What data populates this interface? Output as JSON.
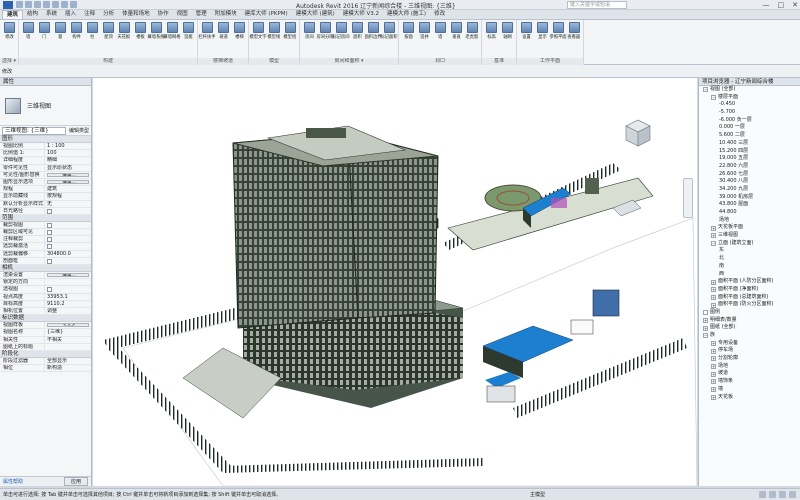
{
  "title_bar": {
    "title": "Autodesk Revit 2016    辽宁新闻综合楼 - 三维视图: {三维}",
    "search_placeholder": "键入关键字或短语",
    "win_controls": [
      "—",
      "□",
      "✕"
    ]
  },
  "ribbon_tabs": [
    "建筑",
    "结构",
    "系统",
    "插入",
    "注释",
    "分析",
    "体量和场地",
    "协作",
    "视图",
    "管理",
    "附加模块",
    "建库大师 (PKPM)",
    "建模大师 (建筑)",
    "建模大师 V3.2",
    "建模大师 (施工)",
    "修改"
  ],
  "active_tab": 0,
  "ribbon_groups": [
    {
      "name": "选择 ▾",
      "buttons": [
        "修改"
      ]
    },
    {
      "name": "构建",
      "buttons": [
        "墙",
        "门",
        "窗",
        "构件",
        "柱",
        "屋顶",
        "天花板",
        "楼板",
        "幕墙系统",
        "幕墙网格",
        "竖梃"
      ]
    },
    {
      "name": "楼梯坡道",
      "buttons": [
        "栏杆扶手",
        "坡道",
        "楼梯"
      ]
    },
    {
      "name": "模型",
      "buttons": [
        "模型文字",
        "模型线",
        "模型组"
      ]
    },
    {
      "name": "房间和面积 ▾",
      "buttons": [
        "房间",
        "房间分隔",
        "标记房间",
        "面积",
        "面积边界",
        "标记面积"
      ]
    },
    {
      "name": "洞口",
      "buttons": [
        "按面",
        "竖井",
        "墙",
        "垂直",
        "老虎窗"
      ]
    },
    {
      "name": "基准",
      "buttons": [
        "标高",
        "轴网"
      ]
    },
    {
      "name": "工作平面",
      "buttons": [
        "设置",
        "显示",
        "参照平面",
        "查看器"
      ]
    }
  ],
  "subbar": {
    "modify_label": "修改"
  },
  "properties": {
    "header": "属性",
    "type_name": "三维视图",
    "selector": "三维视图: {三维}",
    "edit_type": "编辑类型",
    "sections": [
      {
        "title": "图形",
        "rows": [
          {
            "k": "视图比例",
            "v": "1 : 100"
          },
          {
            "k": "比例值 1:",
            "v": "100"
          },
          {
            "k": "详细程度",
            "v": "精细"
          },
          {
            "k": "零件可见性",
            "v": "显示原状态"
          },
          {
            "k": "可见性/图形替换",
            "v": "编辑...",
            "btn": true
          },
          {
            "k": "图形显示选项",
            "v": "编辑...",
            "btn": true
          },
          {
            "k": "规程",
            "v": "建筑"
          },
          {
            "k": "显示隐藏线",
            "v": "按规程"
          },
          {
            "k": "默认分析显示样式",
            "v": "无"
          },
          {
            "k": "日光路径",
            "v": "",
            "chk": true
          }
        ]
      },
      {
        "title": "范围",
        "rows": [
          {
            "k": "裁剪视图",
            "v": "",
            "chk": true
          },
          {
            "k": "裁剪区域可见",
            "v": "",
            "chk": true
          },
          {
            "k": "注释裁剪",
            "v": "",
            "chk": true
          },
          {
            "k": "远剪裁激活",
            "v": "",
            "chk": true
          },
          {
            "k": "远剪裁偏移",
            "v": "304800.0"
          },
          {
            "k": "剖面框",
            "v": "",
            "chk": true
          }
        ]
      },
      {
        "title": "相机",
        "rows": [
          {
            "k": "渲染设置",
            "v": "编辑...",
            "btn": true
          },
          {
            "k": "锁定的方向",
            "v": ""
          },
          {
            "k": "透视图",
            "v": "",
            "chk": true
          },
          {
            "k": "视点高度",
            "v": "33953.1"
          },
          {
            "k": "目标高度",
            "v": "9110.2"
          },
          {
            "k": "相机位置",
            "v": "调整"
          }
        ]
      },
      {
        "title": "标识数据",
        "rows": [
          {
            "k": "视图样板",
            "v": "<无>",
            "btn": true
          },
          {
            "k": "视图名称",
            "v": "{三维}"
          },
          {
            "k": "相关性",
            "v": "不相关"
          },
          {
            "k": "图纸上的标题",
            "v": ""
          }
        ]
      },
      {
        "title": "阶段化",
        "rows": [
          {
            "k": "阶段过滤器",
            "v": "全部显示"
          },
          {
            "k": "相位",
            "v": "新构造"
          }
        ]
      }
    ],
    "help_link": "属性帮助",
    "apply": "应用"
  },
  "browser": {
    "header": "项目浏览器 - 辽宁新闻综合楼",
    "items": [
      {
        "d": 0,
        "t": "[-]",
        "label": "视图 (全部)"
      },
      {
        "d": 1,
        "t": "[-]",
        "label": "楼层平面"
      },
      {
        "d": 2,
        "label": "-0.450"
      },
      {
        "d": 2,
        "label": "-5.700"
      },
      {
        "d": 2,
        "label": "-6.000 负一层"
      },
      {
        "d": 2,
        "label": "0.000 一层"
      },
      {
        "d": 2,
        "label": "5.600 二层"
      },
      {
        "d": 2,
        "label": "10.400 三层"
      },
      {
        "d": 2,
        "label": "15.200 四层"
      },
      {
        "d": 2,
        "label": "19.000 五层"
      },
      {
        "d": 2,
        "label": "22.800 六层"
      },
      {
        "d": 2,
        "label": "26.600 七层"
      },
      {
        "d": 2,
        "label": "30.400 八层"
      },
      {
        "d": 2,
        "label": "34.200 九层"
      },
      {
        "d": 2,
        "label": "39.000 机房层"
      },
      {
        "d": 2,
        "label": "43.800 屋面"
      },
      {
        "d": 2,
        "label": "44.800"
      },
      {
        "d": 2,
        "label": "场地"
      },
      {
        "d": 1,
        "t": "[+]",
        "label": "天花板平面"
      },
      {
        "d": 1,
        "t": "[+]",
        "label": "三维视图"
      },
      {
        "d": 1,
        "t": "[-]",
        "label": "立面 (建筑立面)"
      },
      {
        "d": 2,
        "label": "东"
      },
      {
        "d": 2,
        "label": "北"
      },
      {
        "d": 2,
        "label": "南"
      },
      {
        "d": 2,
        "label": "西"
      },
      {
        "d": 1,
        "t": "[+]",
        "label": "面积平面 (人防分区面积)"
      },
      {
        "d": 1,
        "t": "[+]",
        "label": "面积平面 (净面积)"
      },
      {
        "d": 1,
        "t": "[+]",
        "label": "面积平面 (总建筑面积)"
      },
      {
        "d": 1,
        "t": "[+]",
        "label": "面积平面 (防火分区面积)"
      },
      {
        "d": 0,
        "t": "",
        "label": "图例"
      },
      {
        "d": 0,
        "t": "[+]",
        "label": "明细表/数量"
      },
      {
        "d": 0,
        "t": "[+]",
        "label": "图纸 (全部)"
      },
      {
        "d": 0,
        "t": "[-]",
        "label": "族"
      },
      {
        "d": 1,
        "t": "[+]",
        "label": "专用设备"
      },
      {
        "d": 1,
        "t": "[+]",
        "label": "停车场"
      },
      {
        "d": 1,
        "t": "[+]",
        "label": "分割轮廓"
      },
      {
        "d": 1,
        "t": "[+]",
        "label": "场地"
      },
      {
        "d": 1,
        "t": "[+]",
        "label": "坡道"
      },
      {
        "d": 1,
        "t": "[+]",
        "label": "墙饰条"
      },
      {
        "d": 1,
        "t": "[+]",
        "label": "墙"
      },
      {
        "d": 1,
        "t": "[+]",
        "label": "天花板"
      }
    ]
  },
  "status": {
    "message": "单击可进行选择; 按 Tab 键并单击可选择其他项目; 按 Ctrl 键并单击可将新项目添加到选择集; 按 Shift 键并单击可取消选择。",
    "model": "主模型",
    "scale": "1 : 100"
  },
  "viewcube": {
    "face": "前"
  },
  "colors": {
    "accent": "#2a63b0",
    "building": "#2f3b30",
    "blue_roof": "#1d7fd0",
    "court": "#7a9a6e"
  }
}
